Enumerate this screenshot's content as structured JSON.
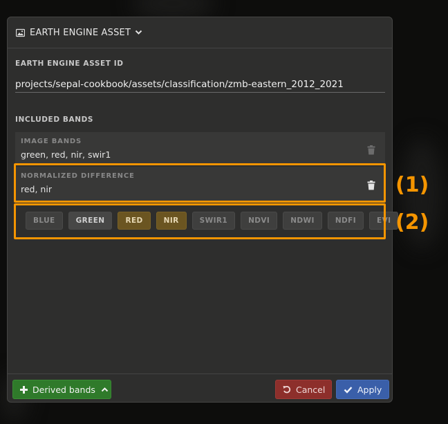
{
  "panel": {
    "title": "EARTH ENGINE ASSET",
    "icon": "image-icon"
  },
  "asset": {
    "label": "EARTH ENGINE ASSET ID",
    "value": "projects/sepal-cookbook/assets/classification/zmb-eastern_2012_2021"
  },
  "bands": {
    "label": "INCLUDED BANDS",
    "cards": [
      {
        "title": "IMAGE BANDS",
        "values": "green, red, nir, swir1"
      },
      {
        "title": "NORMALIZED DIFFERENCE",
        "values": "red, nir"
      }
    ],
    "chips": [
      {
        "label": "BLUE",
        "state": "available"
      },
      {
        "label": "GREEN",
        "state": "used"
      },
      {
        "label": "RED",
        "state": "selected"
      },
      {
        "label": "NIR",
        "state": "selected"
      },
      {
        "label": "SWIR1",
        "state": "available"
      },
      {
        "label": "NDVI",
        "state": "available"
      },
      {
        "label": "NDWI",
        "state": "available"
      },
      {
        "label": "NDFI",
        "state": "available"
      },
      {
        "label": "EVI",
        "state": "available"
      }
    ]
  },
  "annotations": {
    "one": "(1)",
    "two": "(2)",
    "color": "#f59500"
  },
  "footer": {
    "derived_label": "Derived bands",
    "cancel_label": "Cancel",
    "apply_label": "Apply"
  },
  "colors": {
    "panel_bg": "#2e2e2d",
    "selected_chip": "#6b5521",
    "derived": "#2f7a2a",
    "cancel": "#8d2f2b",
    "apply": "#3a5fa9"
  }
}
